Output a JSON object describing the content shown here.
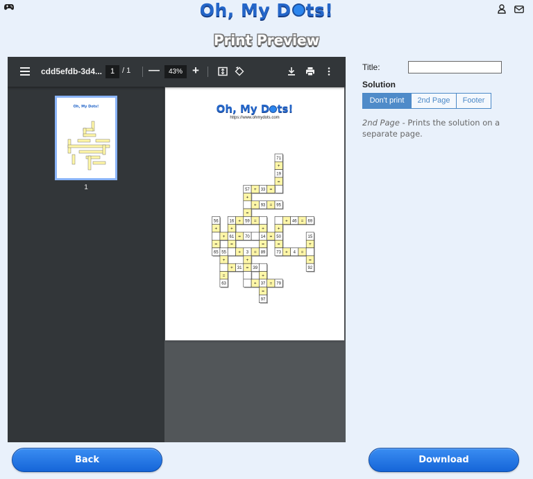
{
  "header": {
    "logo_text_a": "Oh, My D",
    "logo_text_b": "ts!",
    "game_icon": "gamepad-icon",
    "user_icon": "user-icon",
    "mail_icon": "mail-icon"
  },
  "page_title": "Print Preview",
  "viewer": {
    "file_name": "cdd5efdb-3d4...",
    "page_current": "1",
    "page_total": "/ 1",
    "zoom": "43%",
    "thumbnail_label": "1",
    "page_url": "https://www.ohmydots.com",
    "puzzle_numbers": [
      "71",
      "19",
      "57",
      "33",
      "93",
      "95",
      "56",
      "16",
      "59",
      "46",
      "69",
      "61",
      "70",
      "14",
      "50",
      "15",
      "65",
      "55",
      "3",
      "89",
      "73",
      "4",
      "31",
      "39",
      "92",
      "63",
      "37",
      "79",
      "97"
    ]
  },
  "options": {
    "title_label": "Title:",
    "title_value": "",
    "solution_label": "Solution",
    "solution_options": [
      "Don't print",
      "2nd Page",
      "Footer"
    ],
    "solution_selected": "Don't print",
    "description_term": "2nd Page",
    "description_text": " - Prints the solution on a separate page."
  },
  "buttons": {
    "back": "Back",
    "download": "Download"
  },
  "colors": {
    "accent": "#2466c9",
    "button": "#1f74e6",
    "cell_fill": "#fff7a8"
  }
}
